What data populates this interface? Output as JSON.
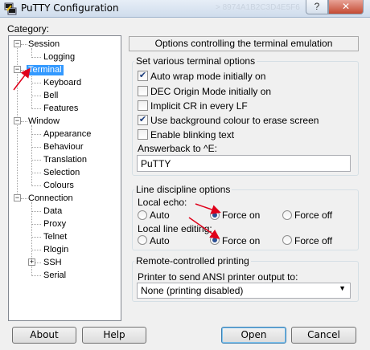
{
  "window": {
    "title": "PuTTY Configuration",
    "background_text": "> 8974A1B2C3D4E5F6",
    "help_button": "?",
    "close_button": "✕"
  },
  "category": {
    "label": "Category:",
    "items": [
      {
        "label": "Session"
      },
      {
        "label": "Logging"
      },
      {
        "label": "Terminal",
        "selected": true
      },
      {
        "label": "Keyboard"
      },
      {
        "label": "Bell"
      },
      {
        "label": "Features"
      },
      {
        "label": "Window"
      },
      {
        "label": "Appearance"
      },
      {
        "label": "Behaviour"
      },
      {
        "label": "Translation"
      },
      {
        "label": "Selection"
      },
      {
        "label": "Colours"
      },
      {
        "label": "Connection"
      },
      {
        "label": "Data"
      },
      {
        "label": "Proxy"
      },
      {
        "label": "Telnet"
      },
      {
        "label": "Rlogin"
      },
      {
        "label": "SSH"
      },
      {
        "label": "Serial"
      }
    ]
  },
  "panel_header": "Options controlling the terminal emulation",
  "terminal_options": {
    "title": "Set various terminal options",
    "checkboxes": [
      {
        "label": "Auto wrap mode initially on",
        "checked": true
      },
      {
        "label": "DEC Origin Mode initially on",
        "checked": false
      },
      {
        "label": "Implicit CR in every LF",
        "checked": false
      },
      {
        "label": "Use background colour to erase screen",
        "checked": true
      },
      {
        "label": "Enable blinking text",
        "checked": false
      }
    ],
    "answerback_label": "Answerback to ^E:",
    "answerback_value": "PuTTY"
  },
  "line_discipline": {
    "title": "Line discipline options",
    "local_echo_label": "Local echo:",
    "local_editing_label": "Local line editing:",
    "options": [
      "Auto",
      "Force on",
      "Force off"
    ],
    "local_echo_selected": "Force on",
    "local_editing_selected": "Force on"
  },
  "printing": {
    "title": "Remote-controlled printing",
    "printer_label": "Printer to send ANSI printer output to:",
    "printer_value": "None (printing disabled)"
  },
  "buttons": {
    "about": "About",
    "help": "Help",
    "open": "Open",
    "cancel": "Cancel"
  },
  "colors": {
    "selection": "#3399ff",
    "annotation_arrow": "#e0001a"
  }
}
